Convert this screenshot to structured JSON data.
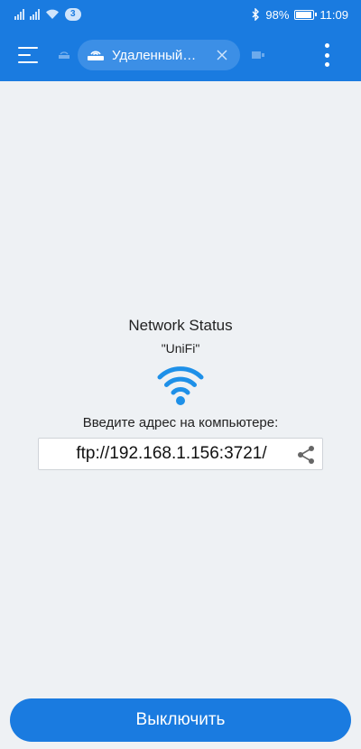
{
  "status_bar": {
    "notification_count": "3",
    "battery_text": "98%",
    "battery_level": 0.98,
    "time": "11:09"
  },
  "toolbar": {
    "tab_label": "Удаленный…",
    "menu_icon": "hamburger-menu-icon",
    "overflow_icon": "more-vertical-icon"
  },
  "main": {
    "title": "Network Status",
    "ssid": "\"UniFi\"",
    "hint": "Введите адрес на компьютере:",
    "address": "ftp://192.168.1.156:3721/"
  },
  "footer": {
    "button_label": "Выключить"
  },
  "colors": {
    "primary": "#1a7be0",
    "wifi": "#1e90e8",
    "background": "#eef1f4"
  }
}
